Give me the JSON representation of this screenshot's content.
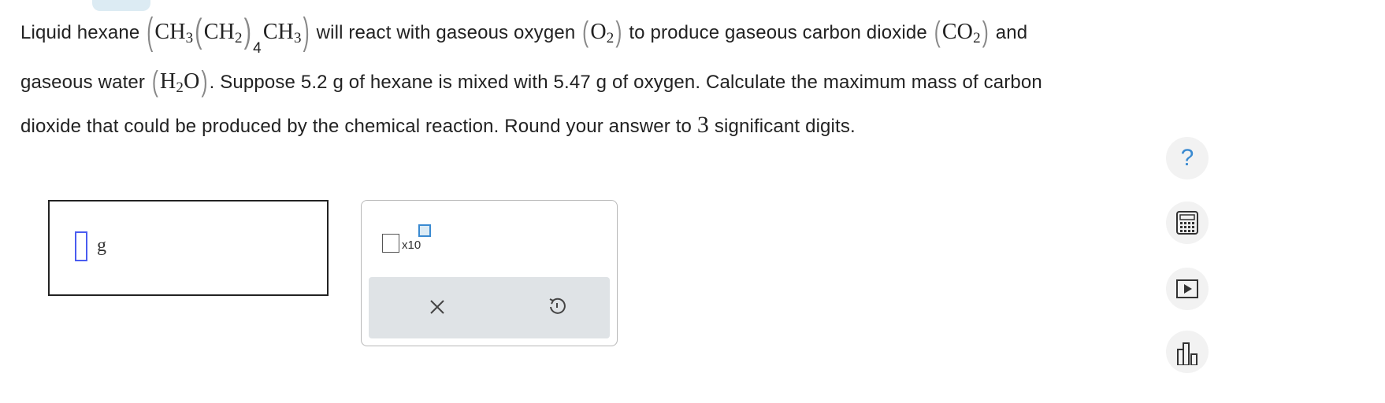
{
  "question": {
    "line1": {
      "text_a": "Liquid hexane",
      "hexane_formula": {
        "p1": "CH",
        "s1": "3",
        "p2": "CH",
        "s2": "2",
        "s3": "4",
        "p3": "CH",
        "s4": "3"
      },
      "text_b": "will react with gaseous oxygen",
      "oxygen_formula": {
        "p1": "O",
        "s1": "2"
      },
      "text_c": "to produce gaseous carbon dioxide",
      "co2_formula": {
        "p1": "CO",
        "s1": "2"
      },
      "text_d": "and"
    },
    "line2": {
      "text_a": "gaseous water",
      "water_formula": {
        "p1": "H",
        "s1": "2",
        "p2": "O"
      },
      "text_b": ". Suppose 5.2 g of hexane is mixed with 5.47 g of oxygen. Calculate the maximum mass of carbon"
    },
    "line3": {
      "text_a": "dioxide that could be produced by the chemical reaction. Round your answer to",
      "digits": "3",
      "text_b": "significant digits."
    }
  },
  "answer": {
    "unit": "g",
    "value": ""
  },
  "keypad": {
    "sci_notation_label": "x10"
  },
  "side_tools": {
    "help_glyph": "?"
  },
  "colors": {
    "accent": "#3a8ad1",
    "cursor": "#4a5cf0",
    "action_bar": "#dfe3e6"
  },
  "icons": [
    "help-icon",
    "calculator-icon",
    "video-icon",
    "periodic-table-icon",
    "clear-icon",
    "undo-icon"
  ]
}
